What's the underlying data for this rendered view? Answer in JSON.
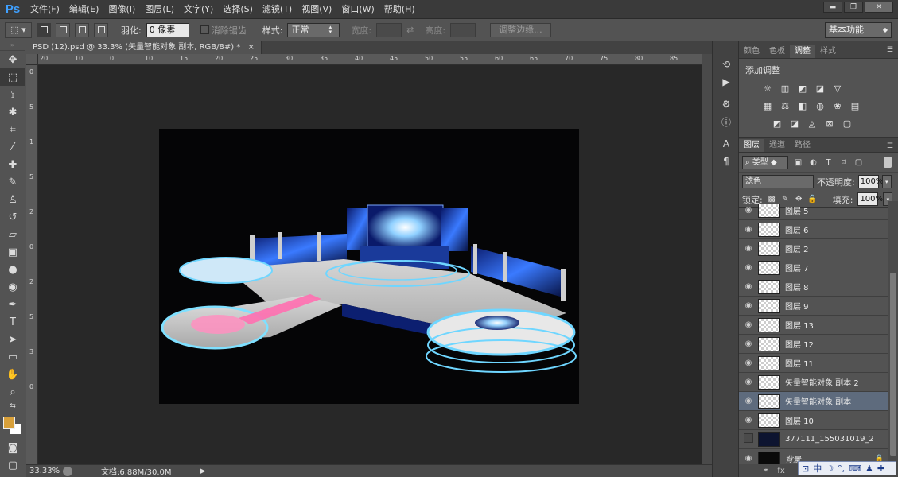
{
  "app": {
    "logo": "Ps"
  },
  "menu": [
    "文件(F)",
    "编辑(E)",
    "图像(I)",
    "图层(L)",
    "文字(Y)",
    "选择(S)",
    "滤镜(T)",
    "视图(V)",
    "窗口(W)",
    "帮助(H)"
  ],
  "window_controls": {
    "minimize": "▬",
    "restore": "❐",
    "close": "✕"
  },
  "options": {
    "feather_label": "羽化:",
    "feather_value": "0 像素",
    "antialias_label": "消除锯齿",
    "style_label": "样式:",
    "style_value": "正常",
    "width_label": "宽度:",
    "height_label": "高度:",
    "refine_label": "调整边缘...",
    "workspace": "基本功能"
  },
  "document": {
    "tab_title": "PSD (12).psd @ 33.3% (矢量智能对象 副本, RGB/8#) *",
    "tab_close": "×",
    "h_ruler_ticks": [
      "20",
      "10",
      "0",
      "10",
      "15",
      "20",
      "25",
      "30",
      "35",
      "40",
      "45",
      "50",
      "55",
      "60",
      "65",
      "70",
      "75",
      "80",
      "85"
    ],
    "v_ruler_ticks": [
      "0",
      "5",
      "1",
      "5",
      "2",
      "0",
      "2",
      "5",
      "3",
      "0"
    ]
  },
  "status": {
    "zoom": "33.33%",
    "doc_size": "文档:6.88M/30.0M",
    "arrow": "▶"
  },
  "adjust_panel": {
    "tabs": [
      "颜色",
      "色板",
      "调整",
      "样式"
    ],
    "active_tab": "调整",
    "title": "添加调整"
  },
  "layers_panel": {
    "tabs": [
      "图层",
      "通道",
      "路径"
    ],
    "active_tab": "图层",
    "filter_kind": "类型",
    "blend_mode": "滤色",
    "opacity_label": "不透明度:",
    "opacity_value": "100%",
    "lock_label": "锁定:",
    "fill_label": "填充:",
    "fill_value": "100%",
    "layers": [
      {
        "name": "图层 5",
        "visible": true,
        "thumb": "checker"
      },
      {
        "name": "图层 6",
        "visible": true,
        "thumb": "checker"
      },
      {
        "name": "图层 2",
        "visible": true,
        "thumb": "checker"
      },
      {
        "name": "图层 7",
        "visible": true,
        "thumb": "checker"
      },
      {
        "name": "图层 8",
        "visible": true,
        "thumb": "checker"
      },
      {
        "name": "图层 9",
        "visible": true,
        "thumb": "checker"
      },
      {
        "name": "图层 13",
        "visible": true,
        "thumb": "checker"
      },
      {
        "name": "图层 12",
        "visible": true,
        "thumb": "checker"
      },
      {
        "name": "图层 11",
        "visible": true,
        "thumb": "checker"
      },
      {
        "name": "矢量智能对象 副本 2",
        "visible": true,
        "thumb": "checker"
      },
      {
        "name": "矢量智能对象 副本",
        "visible": true,
        "thumb": "checker",
        "selected": true
      },
      {
        "name": "图层 10",
        "visible": true,
        "thumb": "checker"
      },
      {
        "name": "377111_155031019_2",
        "visible": false,
        "thumb": "dark"
      },
      {
        "name": "背景",
        "visible": true,
        "thumb": "black",
        "locked": true
      }
    ]
  },
  "ime": {
    "mode": "中"
  },
  "colors": {
    "foreground": "#d8a03a",
    "background": "#ffffff",
    "accent": "#3fa0ff"
  }
}
